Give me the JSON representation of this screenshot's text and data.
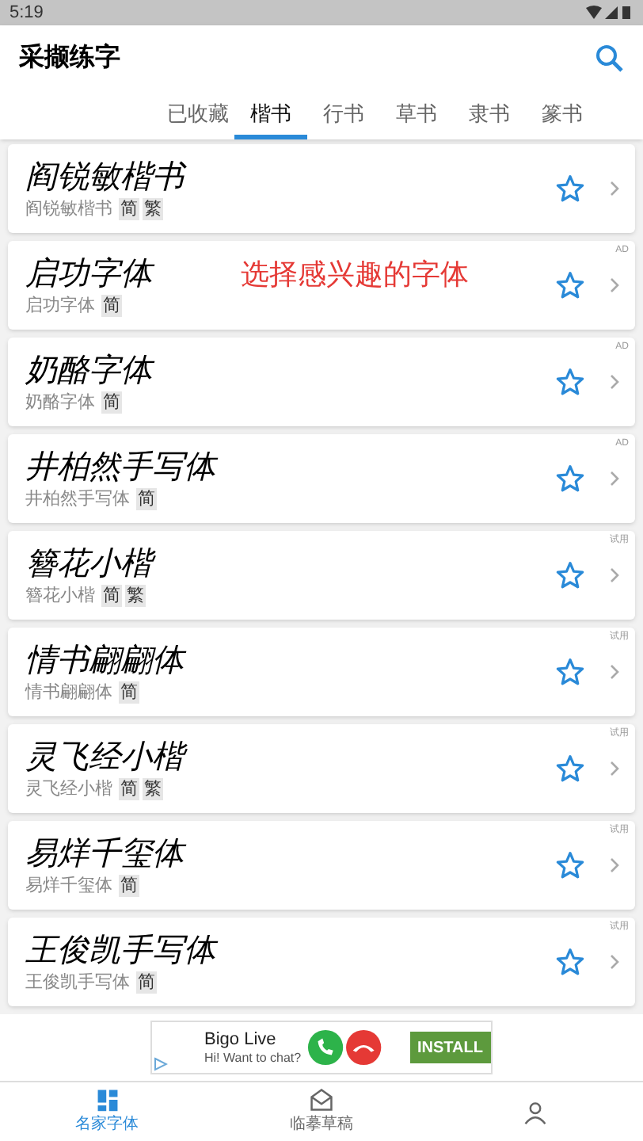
{
  "status_bar": {
    "time": "5:19"
  },
  "app_bar": {
    "title": "采撷练字"
  },
  "tabs": [
    {
      "label": "已收藏",
      "selected": false
    },
    {
      "label": "楷书",
      "selected": true
    },
    {
      "label": "行书",
      "selected": false
    },
    {
      "label": "草书",
      "selected": false
    },
    {
      "label": "隶书",
      "selected": false
    },
    {
      "label": "篆书",
      "selected": false
    }
  ],
  "fonts": [
    {
      "sample": "阎锐敏楷书",
      "name": "阎锐敏楷书",
      "tags": [
        "简",
        "繁"
      ]
    },
    {
      "sample": "启功字体",
      "name": "启功字体",
      "tags": [
        "简"
      ],
      "badge": "AD",
      "annotation": "选择感兴趣的字体"
    },
    {
      "sample": "奶酪字体",
      "name": "奶酪字体",
      "tags": [
        "简"
      ],
      "badge": "AD"
    },
    {
      "sample": "井柏然手写体",
      "name": "井柏然手写体",
      "tags": [
        "简"
      ],
      "badge": "AD"
    },
    {
      "sample": "簪花小楷",
      "name": "簪花小楷",
      "tags": [
        "简",
        "繁"
      ],
      "badge": "试用"
    },
    {
      "sample": "情书翩翩体",
      "name": "情书翩翩体",
      "tags": [
        "简"
      ],
      "badge": "试用"
    },
    {
      "sample": "灵飞经小楷",
      "name": "灵飞经小楷",
      "tags": [
        "简",
        "繁"
      ],
      "badge": "试用"
    },
    {
      "sample": "易烊千玺体",
      "name": "易烊千玺体",
      "tags": [
        "简"
      ],
      "badge": "试用"
    },
    {
      "sample": "王俊凯手写体",
      "name": "王俊凯手写体",
      "tags": [
        "简"
      ],
      "badge": "试用"
    }
  ],
  "ad_banner": {
    "title": "Bigo Live",
    "subtitle": "Hi! Want to chat?",
    "button": "INSTALL"
  },
  "bottom_nav": [
    {
      "label": "名家字体",
      "selected": true,
      "kind": "grid"
    },
    {
      "label": "临摹草稿",
      "selected": false,
      "kind": "mail"
    },
    {
      "selected": false,
      "kind": "person"
    }
  ]
}
